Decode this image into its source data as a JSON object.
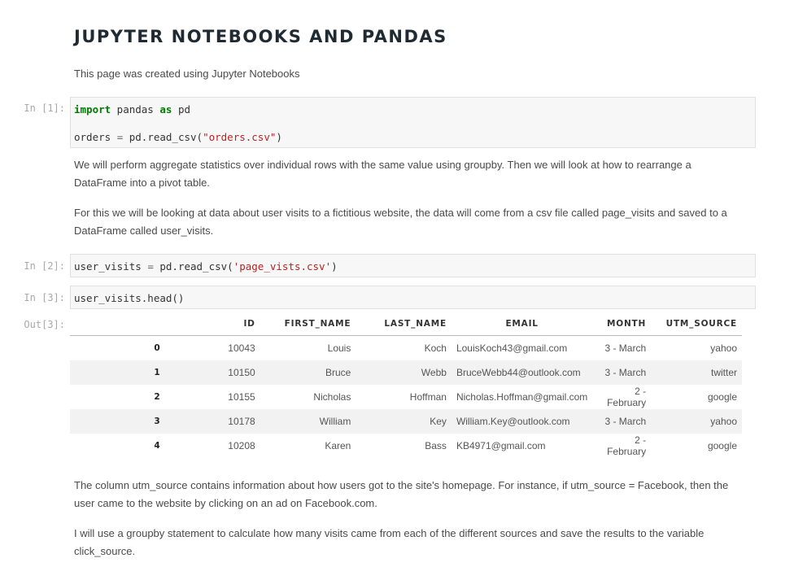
{
  "title": "JUPYTER NOTEBOOKS AND PANDAS",
  "intro": "This page was created using Jupyter Notebooks",
  "cells": {
    "c1": {
      "prompt": "In [1]:",
      "l1_kw1": "import",
      "l1_mid": " pandas ",
      "l1_kw2": "as",
      "l1_end": " pd",
      "l2_pre": "orders ",
      "l2_eq": "=",
      "l2_mid": " pd.read_csv(",
      "l2_str": "\"orders.csv\"",
      "l2_end": ")"
    },
    "c2": {
      "prompt": "In [2]:",
      "pre": "user_visits ",
      "eq": "=",
      "mid": " pd.read_csv(",
      "str": "'page_vists.csv'",
      "end": ")"
    },
    "c3": {
      "prompt": "In [3]:",
      "code": "user_visits.head()"
    },
    "out3": {
      "prompt": "Out[3]:"
    }
  },
  "md1": "We will perform aggregate statistics over individual rows with the same value using groupby. Then we will look at how to rearrange a DataFrame into a pivot table.",
  "md2": "For this we will be looking at data about user visits to a fictitious website, the data will come from a csv file called page_visits and saved to a DataFrame called user_visits.",
  "md3": "The column utm_source contains information about how users got to the site's homepage. For instance, if utm_source = Facebook, then the user came to the website by clicking on an ad on Facebook.com.",
  "md4": "I will use a groupby statement to calculate how many visits came from each of the different sources and save the results to the variable click_source.",
  "table": {
    "headers": [
      "",
      "ID",
      "FIRST_NAME",
      "LAST_NAME",
      "EMAIL",
      "MONTH",
      "UTM_SOURCE"
    ],
    "rows": [
      [
        "0",
        "10043",
        "Louis",
        "Koch",
        "LouisKoch43@gmail.com",
        "3 - March",
        "yahoo"
      ],
      [
        "1",
        "10150",
        "Bruce",
        "Webb",
        "BruceWebb44@outlook.com",
        "3 - March",
        "twitter"
      ],
      [
        "2",
        "10155",
        "Nicholas",
        "Hoffman",
        "Nicholas.Hoffman@gmail.com",
        "2 - February",
        "google"
      ],
      [
        "3",
        "10178",
        "William",
        "Key",
        "William.Key@outlook.com",
        "3 - March",
        "yahoo"
      ],
      [
        "4",
        "10208",
        "Karen",
        "Bass",
        "KB4971@gmail.com",
        "2 - February",
        "google"
      ]
    ]
  }
}
